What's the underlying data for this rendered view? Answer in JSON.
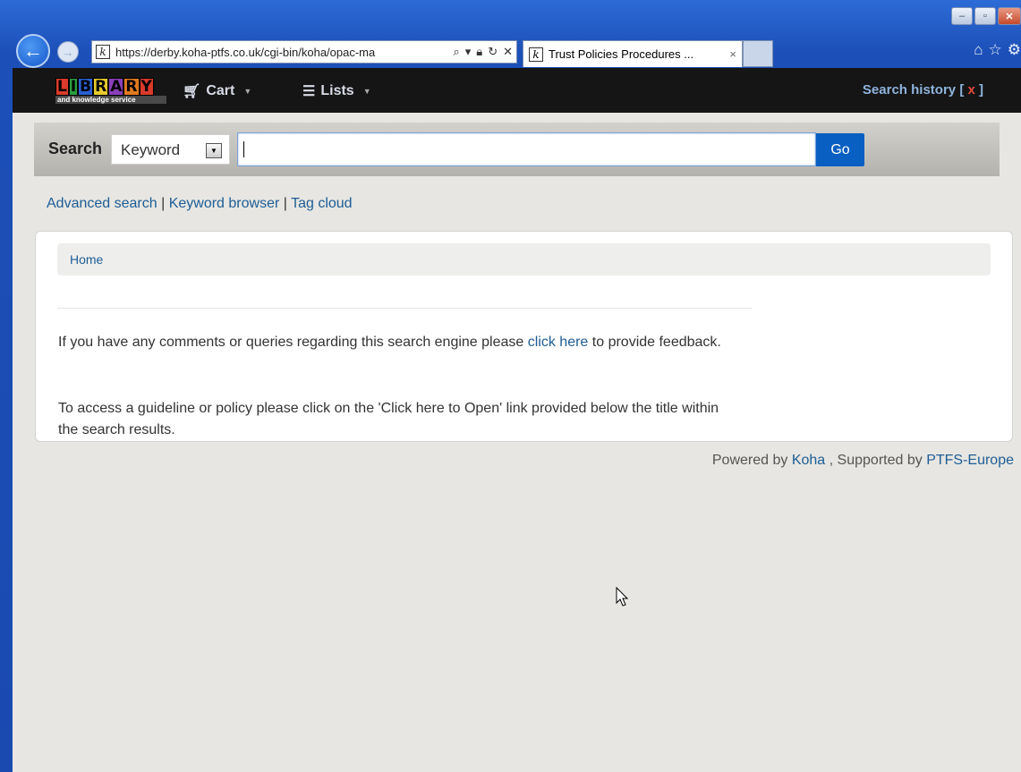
{
  "browser": {
    "url": "https://derby.koha-ptfs.co.uk/cgi-bin/koha/opac-ma",
    "url_host_bold": "koha-ptfs.co.uk",
    "tab_title": "Trust Policies Procedures ...",
    "tab_close": "×",
    "back_glyph": "←",
    "forward_glyph": "→",
    "addr_tools": [
      "⌕",
      "▾",
      "🔒",
      "↻",
      "✕"
    ],
    "icons": [
      "home-icon",
      "star-icon",
      "gear-icon"
    ],
    "window_buttons": [
      "–",
      "▫",
      "✕"
    ]
  },
  "navbar": {
    "logo_letters": [
      "L",
      "I",
      "B",
      "R",
      "A",
      "R",
      "Y"
    ],
    "logo_colors": [
      "#d93a2b",
      "#2a9d3f",
      "#2b5fd1",
      "#e7c92c",
      "#8a3fb8",
      "#e07a1f",
      "#d93a2b"
    ],
    "logo_subtitle": "and knowledge service",
    "cart_label": "Cart",
    "lists_label": "Lists",
    "search_history_label": "Search history",
    "search_history_open": "[",
    "search_history_x": "x",
    "search_history_close": "]"
  },
  "search": {
    "label": "Search",
    "select_value": "Keyword",
    "input_value": "",
    "go_label": "Go"
  },
  "links": {
    "advanced": "Advanced search",
    "sep": "|",
    "keyword_browser": "Keyword browser",
    "tag_cloud": "Tag cloud"
  },
  "breadcrumb": {
    "home": "Home"
  },
  "content": {
    "p1_before": "If you have any comments or queries regarding this search engine please ",
    "p1_link": "click here",
    "p1_after": " to provide feedback.",
    "p2": "To access a guideline or policy please click on the 'Click here to Open' link provided below the title within the search results."
  },
  "footer": {
    "powered_by": "Powered by",
    "koha": "Koha",
    "supported_by": ", Supported by",
    "ptfs": "PTFS-Europe"
  },
  "colors": {
    "navbar_bg": "#151515",
    "link": "#1d5d95",
    "go_button": "#0a5fc2",
    "page_bg": "#e7e6e2"
  }
}
